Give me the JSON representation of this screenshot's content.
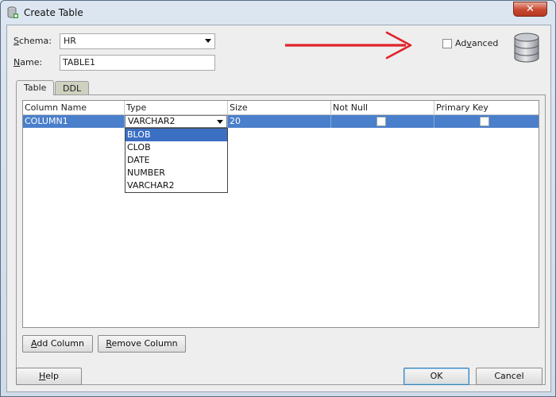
{
  "window": {
    "title": "Create Table",
    "close_glyph": "✕"
  },
  "form": {
    "schema_label_prefix": "S",
    "schema_label_rest": "chema:",
    "schema_value": "HR",
    "name_label_prefix": "N",
    "name_label_rest": "ame:",
    "name_value": "TABLE1",
    "advanced_label_prefix": "Ad",
    "advanced_label_ul": "v",
    "advanced_label_rest": "anced",
    "advanced_checked": false
  },
  "tabs": [
    {
      "label": "Table",
      "active": true
    },
    {
      "label": "DDL",
      "active": false
    }
  ],
  "table_grid": {
    "columns": [
      "Column Name",
      "Type",
      "Size",
      "Not Null",
      "Primary Key"
    ],
    "rows": [
      {
        "column_name": "COLUMN1",
        "type": "VARCHAR2",
        "size": "20",
        "not_null": false,
        "primary_key": false
      }
    ],
    "type_options": [
      "BLOB",
      "CLOB",
      "DATE",
      "NUMBER",
      "VARCHAR2"
    ],
    "highlighted_option": "BLOB"
  },
  "buttons": {
    "add_column_prefix": "A",
    "add_column_rest": "dd Column",
    "remove_column_prefix": "R",
    "remove_column_rest": "emove Column",
    "help_prefix": "H",
    "help_rest": "elp",
    "ok": "OK",
    "cancel": "Cancel"
  },
  "colors": {
    "selection": "#4a7fcb",
    "annotation_arrow": "#e0232a"
  },
  "icons": [
    "create-table-icon",
    "close-icon",
    "database-icon",
    "annotation-arrow"
  ]
}
